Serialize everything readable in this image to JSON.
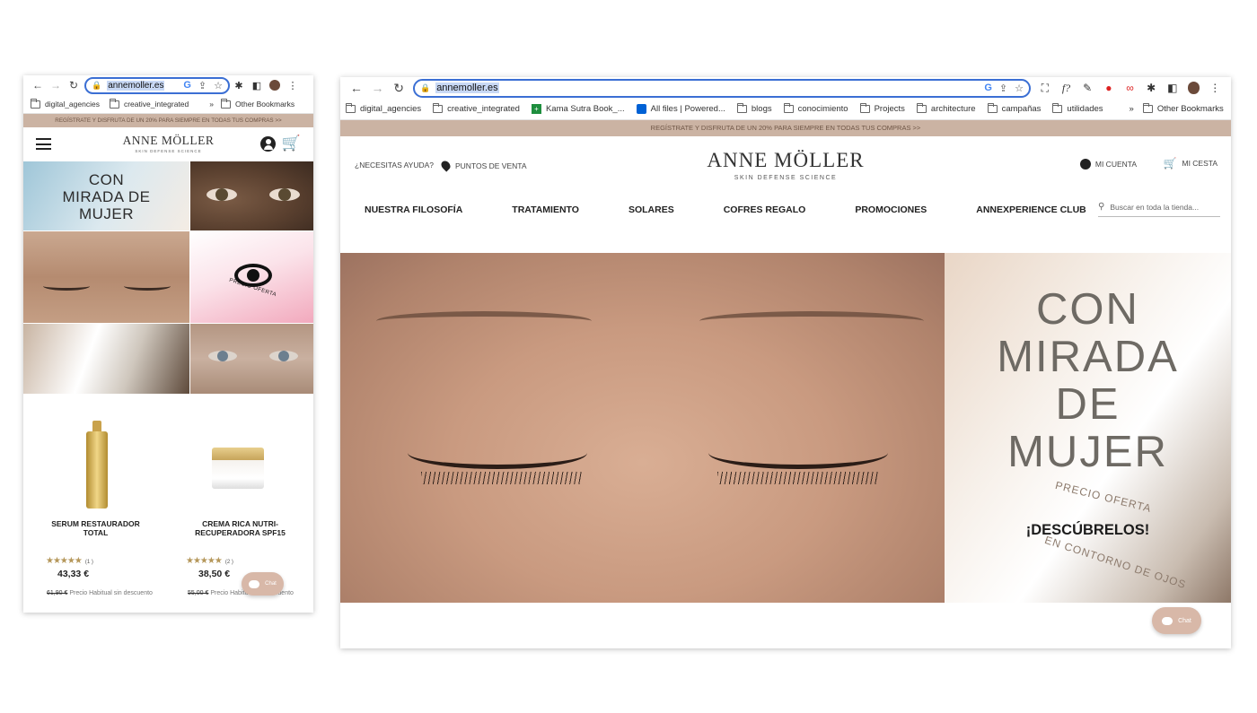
{
  "browser": {
    "url": "annemoller.es",
    "bookmarks_mobile": [
      "digital_agencies",
      "creative_integrated"
    ],
    "bookmarks_desktop": [
      "digital_agencies",
      "creative_integrated",
      "Kama Sutra Book_...",
      "All files | Powered...",
      "blogs",
      "conocimiento",
      "Projects",
      "architecture",
      "campañas",
      "utilidades"
    ],
    "more_bookmarks": "»",
    "other_bookmarks": "Other Bookmarks"
  },
  "promo": "REGÍSTRATE Y DISFRUTA DE UN 20% PARA SIEMPRE EN TODAS TUS COMPRAS >>",
  "brand": {
    "name": "ANNE MÖLLER",
    "tagline": "SKIN DEFENSE SCIENCE"
  },
  "header": {
    "help": "¿NECESITAS AYUDA?",
    "points": "PUNTOS DE VENTA",
    "account": "MI CUENTA",
    "cart": "MI CESTA",
    "search_placeholder": "Buscar en toda la tienda..."
  },
  "nav": [
    "NUESTRA FILOSOFÍA",
    "TRATAMIENTO",
    "SOLARES",
    "COFRES REGALO",
    "PROMOCIONES",
    "ANNEXPERIENCE CLUB"
  ],
  "hero": {
    "headline_lines": [
      "CON",
      "MIRADA",
      "DE",
      "MUJER"
    ],
    "mobile_headline_lines": [
      "CON",
      "MIRADA DE",
      "MUJER"
    ],
    "offer": "PRECIO OFERTA",
    "cta": "¡DESCÚBRELOS!",
    "category": "EN CONTORNO DE OJOS"
  },
  "products": [
    {
      "name": "SERUM RESTAURADOR TOTAL",
      "rating": "★★★★★",
      "reviews": "(1  )",
      "price": "43,33 €",
      "old_price": "61,90 €",
      "old_label": "Precio Habitual sin descuento"
    },
    {
      "name": "CREMA RICA NUTRI-RECUPERADORA SPF15",
      "rating": "★★★★★",
      "reviews": "(2  )",
      "price": "38,50 €",
      "old_price": "55,00 €",
      "old_label": "Precio Habitual sin descuento"
    }
  ],
  "chat": "Chat",
  "colors": {
    "promo_bg": "#cbb3a3",
    "accent_blue": "#3b6fd4",
    "star": "#b5975a",
    "chat": "#d8b8a8"
  }
}
